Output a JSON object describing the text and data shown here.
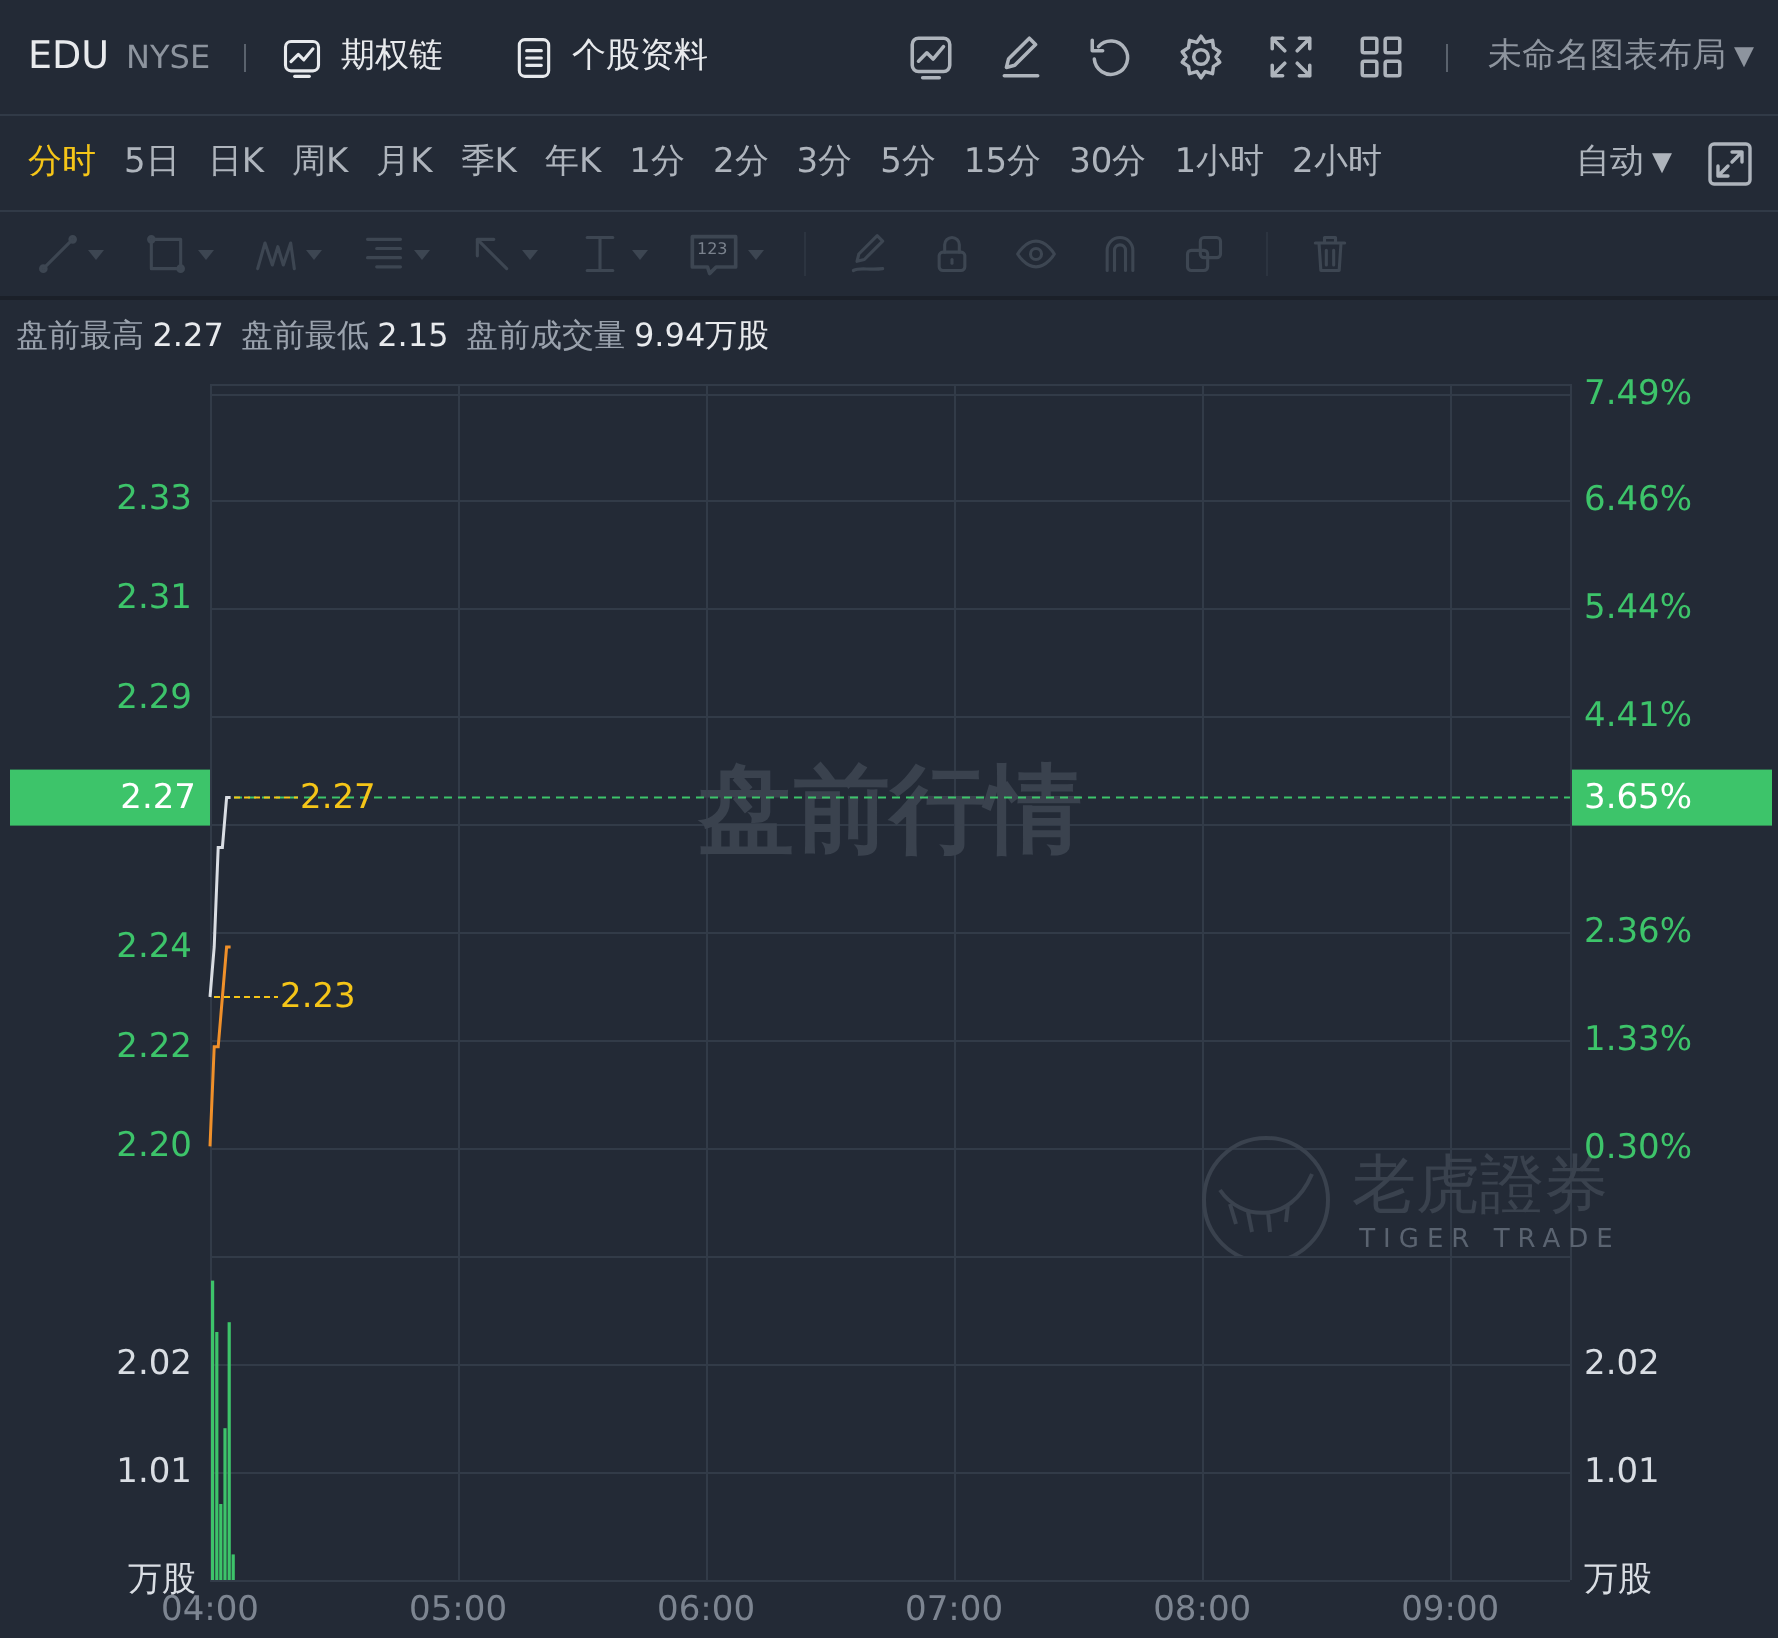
{
  "header": {
    "symbol": "EDU",
    "exchange": "NYSE",
    "links": [
      {
        "kind": "chart",
        "label": "期权链"
      },
      {
        "kind": "doc",
        "label": "个股资料"
      }
    ],
    "layout_menu": "未命名图表布局",
    "caret": "▼"
  },
  "periods": [
    {
      "label": "分时",
      "selected": true
    },
    {
      "label": "5日",
      "selected": false
    },
    {
      "label": "日K",
      "selected": false
    },
    {
      "label": "周K",
      "selected": false
    },
    {
      "label": "月K",
      "selected": false
    },
    {
      "label": "季K",
      "selected": false
    },
    {
      "label": "年K",
      "selected": false
    },
    {
      "label": "1分",
      "selected": false
    },
    {
      "label": "2分",
      "selected": false
    },
    {
      "label": "3分",
      "selected": false
    },
    {
      "label": "5分",
      "selected": false
    },
    {
      "label": "15分",
      "selected": false
    },
    {
      "label": "30分",
      "selected": false
    },
    {
      "label": "1小时",
      "selected": false
    },
    {
      "label": "2小时",
      "selected": false
    }
  ],
  "scale_menu": {
    "label": "自动",
    "caret": "▼"
  },
  "drawing_tools": {
    "disabled": true,
    "items": [
      {
        "kind": "line",
        "menu": true
      },
      {
        "kind": "rect",
        "menu": true
      },
      {
        "kind": "wave",
        "menu": true
      },
      {
        "kind": "fib",
        "menu": true
      },
      {
        "kind": "arrow",
        "menu": true
      },
      {
        "kind": "measure",
        "menu": true
      },
      {
        "kind": "tag",
        "menu": true,
        "label": "123"
      },
      {
        "kind": "sep"
      },
      {
        "kind": "pen",
        "menu": false
      },
      {
        "kind": "lock",
        "menu": false
      },
      {
        "kind": "eye",
        "menu": false
      },
      {
        "kind": "magnet",
        "menu": false
      },
      {
        "kind": "layers",
        "menu": false
      },
      {
        "kind": "sep"
      },
      {
        "kind": "trash",
        "menu": false
      }
    ]
  },
  "stats": [
    {
      "label": "盘前最高",
      "value": "2.27"
    },
    {
      "label": "盘前最低",
      "value": "2.15"
    },
    {
      "label": "盘前成交量",
      "value": "9.94万股"
    }
  ],
  "session_label": "盘前行情",
  "watermark": {
    "name": "老虎證券",
    "sub": "TIGER TRADE"
  },
  "price_chart": {
    "last_price_tag": "2.27",
    "change_tag": "3.65%",
    "right_axis": [
      "7.49%",
      "6.46%",
      "5.44%",
      "4.41%",
      "2.36%",
      "1.33%",
      "0.30%"
    ],
    "price_labels": [
      "2.27",
      "2.23"
    ],
    "chart_data": {
      "type": "line",
      "grid": true,
      "ref_lines": [
        {
          "axis": "y",
          "value": 2.27,
          "color": "#3dc46a"
        }
      ],
      "x": [
        4,
        4.017,
        4.033,
        4.05,
        4.067,
        4.083
      ],
      "xlim": [
        4,
        9.483
      ],
      "ylim": [
        2.178,
        2.351
      ],
      "yticks": [
        {
          "value": 2.33,
          "label": "2.33"
        },
        {
          "value": 2.31,
          "label": "2.31"
        },
        {
          "value": 2.29,
          "label": "2.29"
        },
        {
          "value": 2.24,
          "label": "2.24"
        },
        {
          "value": 2.22,
          "label": "2.22"
        },
        {
          "value": 2.2,
          "label": "2.20"
        }
      ],
      "series": [
        {
          "color": "#d9dde3",
          "values": [
            2.23,
            2.24,
            2.26,
            2.26,
            2.27,
            2.27
          ]
        },
        {
          "color": "#f0902a",
          "values": [
            2.2,
            2.22,
            2.22,
            2.23,
            2.24,
            2.24
          ]
        }
      ]
    }
  },
  "volume_chart": {
    "unit_label": "万股",
    "right_axis": [
      "2.02",
      "1.01",
      "万股"
    ],
    "chart_data": {
      "type": "bar",
      "grid": true,
      "x": [
        4,
        4.017,
        4.033,
        4.05,
        4.067,
        4.083
      ],
      "xlim": [
        4,
        9.483
      ],
      "ylim": [
        0,
        3.03
      ],
      "xticks": [
        {
          "value": 4,
          "label": "04:00"
        },
        {
          "value": 5,
          "label": "05:00"
        },
        {
          "value": 6,
          "label": "06:00"
        },
        {
          "value": 7,
          "label": "07:00"
        },
        {
          "value": 8,
          "label": "08:00"
        },
        {
          "value": 9,
          "label": "09:00"
        }
      ],
      "yticks": [
        {
          "value": 2.02,
          "label": "2.02"
        },
        {
          "value": 1.01,
          "label": "1.01"
        }
      ],
      "series": [
        {
          "color": "#3dc46a",
          "values": [
            2.8,
            2.32,
            0.71,
            1.42,
            2.41,
            0.24
          ]
        }
      ]
    }
  }
}
